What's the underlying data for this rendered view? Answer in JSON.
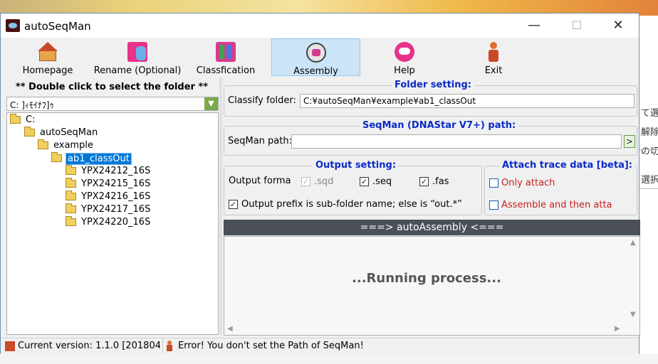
{
  "window": {
    "title": "autoSeqMan",
    "controls": {
      "minimize": "—",
      "maximize": "☐",
      "close": "✕"
    }
  },
  "toolbar": [
    {
      "label": "Homepage",
      "icon": "home-icon"
    },
    {
      "label": "Rename (Optional)",
      "icon": "rename-icon"
    },
    {
      "label": "Classfication",
      "icon": "books-icon"
    },
    {
      "label": "Assembly",
      "icon": "assembly-icon",
      "active": true
    },
    {
      "label": "Help",
      "icon": "chat-bubbles-icon"
    },
    {
      "label": "Exit",
      "icon": "exit-person-icon"
    }
  ],
  "left": {
    "hint": "** Double click to select the folder **",
    "drive": "C: ]ｨﾓｲﾅﾌ]ｩ",
    "tree": [
      {
        "label": "C:",
        "level": 0
      },
      {
        "label": "autoSeqMan",
        "level": 1
      },
      {
        "label": "example",
        "level": 2
      },
      {
        "label": "ab1_classOut",
        "level": 3,
        "selected": true
      },
      {
        "label": "YPX24212_16S",
        "level": 4
      },
      {
        "label": "YPX24215_16S",
        "level": 4
      },
      {
        "label": "YPX24216_16S",
        "level": 4
      },
      {
        "label": "YPX24217_16S",
        "level": 4
      },
      {
        "label": "YPX24220_16S",
        "level": 4
      }
    ]
  },
  "folder_setting": {
    "title": "Folder setting:",
    "classify_label": "Classify folder:",
    "classify_value": "C:¥autoSeqMan¥example¥ab1_classOut"
  },
  "seqman": {
    "title": "SeqMan (DNAStar V7+) path:",
    "path_label": "SeqMan path:",
    "path_value": "",
    "browse": ">"
  },
  "output_setting": {
    "title": "Output setting:",
    "format_label": "Output forma",
    "sqd": {
      "label": ".sqd",
      "checked": true,
      "disabled": true
    },
    "seq": {
      "label": ".seq",
      "checked": true
    },
    "fas": {
      "label": ".fas",
      "checked": true
    },
    "prefix": {
      "label": "Output prefix is sub-folder name; else is “out.*”",
      "checked": true
    }
  },
  "attach": {
    "title": "Attach trace data [beta]:",
    "only_attach": "Only attach",
    "assemble_attach": "Assemble and then atta"
  },
  "banner": "===> autoAssembly <===",
  "output_text": "...Running process...",
  "status": {
    "version": "Current version: 1.1.0 [201804",
    "message": "Error! You don't set the Path of SeqMan!"
  },
  "background": {
    "lines": [
      "て選",
      "解除",
      "の切",
      "選択"
    ]
  },
  "colors": {
    "group_title": "#0a2ac8",
    "attach_text": "#c81e1e",
    "selected": "#0078d7",
    "banner": "#4a4f58"
  }
}
